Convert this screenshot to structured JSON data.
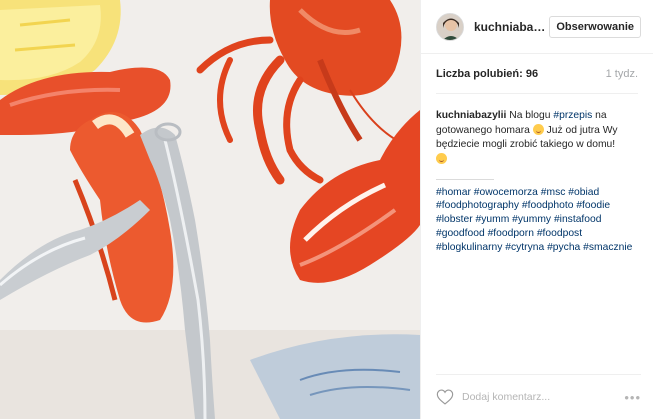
{
  "post": {
    "image_alt": ""
  },
  "header": {
    "username": "kuchniabazy..",
    "follow_label": "Obserwowanie"
  },
  "stats": {
    "likes": "Liczba polubień: 96",
    "time": "1 tydz."
  },
  "caption": {
    "author": "kuchniabazylii",
    "text_1": "Na blogu",
    "tag_1": "#przepis",
    "text_2": "na gotowanego homara",
    "text_3": "Już od jutra Wy będziecie mogli zrobić takiego w domu!",
    "emoji_1": "smiling-face",
    "emoji_2": "face-savoring-food"
  },
  "hashtags": [
    "#homar",
    "#owocemorza",
    "#msc",
    "#obiad",
    "#foodphotography",
    "#foodphoto",
    "#foodie",
    "#lobster",
    "#yumm",
    "#yummy",
    "#instafood",
    "#goodfood",
    "#foodporn",
    "#foodpost",
    "#blogkulinarny",
    "#cytryna",
    "#pycha",
    "#smacznie"
  ],
  "comment": {
    "placeholder": "Dodaj komentarz...",
    "more": "•••"
  },
  "colors": {
    "hashtag": "#003569",
    "text": "#262626",
    "muted": "#a5a7aa",
    "border": "#efefef"
  },
  "icons": {
    "like": "heart-outline-icon",
    "more": "more-options-icon"
  }
}
